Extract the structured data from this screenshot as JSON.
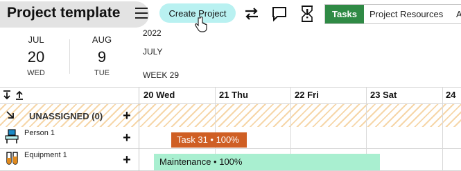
{
  "header": {
    "title": "Project template",
    "create_button": "Create Project",
    "tabs": [
      "Tasks",
      "Project Resources",
      "A"
    ]
  },
  "date_today": {
    "month": "JUL",
    "day": "20",
    "weekday": "WED"
  },
  "date_next": {
    "month": "AUG",
    "day": "9",
    "weekday": "TUE"
  },
  "period": {
    "year": "2022",
    "month": "JULY",
    "week": "WEEK 29"
  },
  "columns": [
    "20 Wed",
    "21 Thu",
    "22 Fri",
    "23 Sat",
    "24"
  ],
  "rows": {
    "unassigned": "UNASSIGNED (0)",
    "person": "Person 1",
    "equipment": "Equipment 1"
  },
  "tasks": [
    {
      "label": "Task 31 • 100%",
      "color": "#cf5f24",
      "text_color": "#ffffff"
    },
    {
      "label": "Maintenance • 100%",
      "color": "#a9efd0",
      "text_color": "#111111"
    }
  ],
  "colors": {
    "accent": "#2f8a45",
    "create_button": "#b9f1f1",
    "unassigned_stripe": "#f6d6a8"
  },
  "icons": {
    "menu": "hamburger-icon",
    "swap": "swap-arrows-icon",
    "comment": "comment-icon",
    "timer": "timer-alert-icon",
    "collapse": "arrow-collapse-icon",
    "person": "person-at-desk-icon",
    "equipment": "test-tubes-icon"
  }
}
